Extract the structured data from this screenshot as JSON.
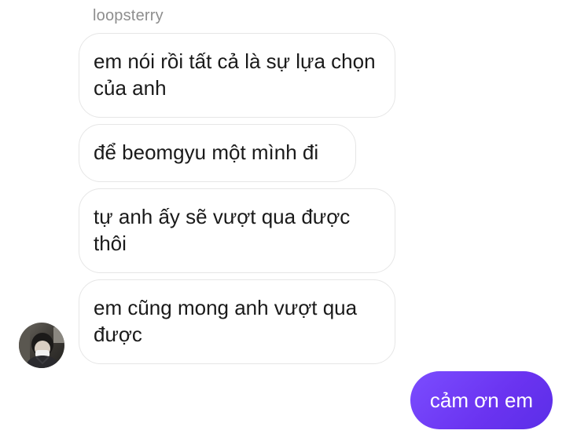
{
  "conversation": {
    "sender_name": "loopsterry",
    "incoming_messages": [
      {
        "text": "em nói rồi tất cả là sự lựa chọn của anh"
      },
      {
        "text": "để beomgyu một mình đi"
      },
      {
        "text": "tự anh ấy sẽ vượt qua được thôi"
      },
      {
        "text": "em cũng mong anh vượt qua được"
      }
    ],
    "outgoing_messages": [
      {
        "text": "cảm ơn em"
      }
    ],
    "avatar_icon": "user-avatar-photo"
  },
  "colors": {
    "incoming_bubble_border": "#e6e6e6",
    "outgoing_bubble": "#6a33f0",
    "sender_name": "#8e8e8e"
  }
}
